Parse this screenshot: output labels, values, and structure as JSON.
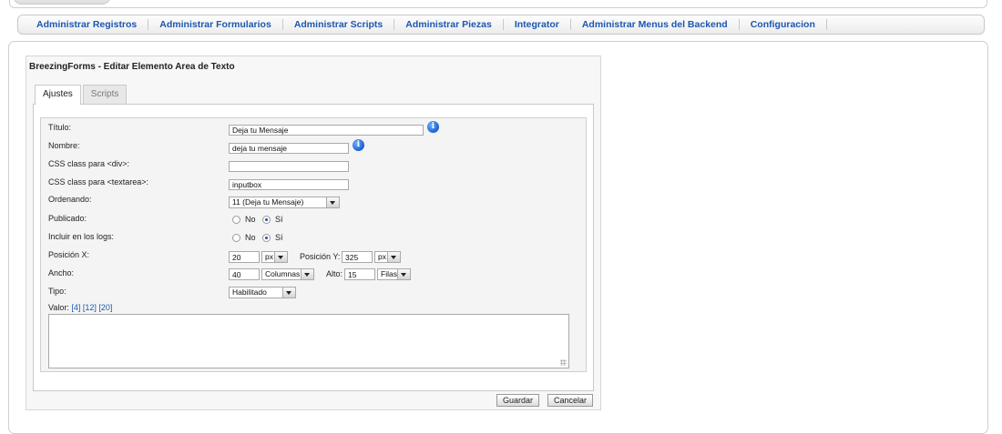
{
  "menu": {
    "items": [
      {
        "id": "registros",
        "label": "Administrar Registros"
      },
      {
        "id": "formularios",
        "label": "Administrar Formularios"
      },
      {
        "id": "scripts",
        "label": "Administrar Scripts"
      },
      {
        "id": "piezas",
        "label": "Administrar Piezas"
      },
      {
        "id": "integrator",
        "label": "Integrator"
      },
      {
        "id": "menus-backend",
        "label": "Administrar Menus del Backend"
      },
      {
        "id": "configuracion",
        "label": "Configuracion"
      }
    ]
  },
  "panel": {
    "title": "BreezingForms - Editar Elemento Area de Texto",
    "tabs": {
      "ajustes": "Ajustes",
      "scripts": "Scripts"
    }
  },
  "form": {
    "titulo": {
      "label": "Título:",
      "value": "Deja tu Mensaje"
    },
    "nombre": {
      "label": "Nombre:",
      "value": "deja tu mensaje"
    },
    "css_div": {
      "label": "CSS class para <div>:",
      "value": ""
    },
    "css_textarea": {
      "label": "CSS class para <textarea>:",
      "value": "inputbox"
    },
    "ordenando": {
      "label": "Ordenando:",
      "value": "11 (Deja tu Mensaje)"
    },
    "publicado": {
      "label": "Publicado:",
      "no": "No",
      "si": "Sí",
      "selected": "si"
    },
    "logs": {
      "label": "Incluir en los logs:",
      "no": "No",
      "si": "Sí",
      "selected": "si"
    },
    "posicion": {
      "label": "Posición X:",
      "x_value": "20",
      "x_unit": "px",
      "y_label": "Posición Y:",
      "y_value": "325",
      "y_unit": "px"
    },
    "ancho": {
      "label": "Ancho:",
      "value": "40",
      "unit": "Columnas",
      "alto_label": "Alto:",
      "alto_value": "15",
      "alto_unit": "Filas"
    },
    "tipo": {
      "label": "Tipo:",
      "value": "Habilitado"
    },
    "valor": {
      "label": "Valor:",
      "links": [
        "[4]",
        "[12]",
        "[20]"
      ],
      "value": ""
    }
  },
  "buttons": {
    "guardar": "Guardar",
    "cancelar": "Cancelar"
  },
  "icons": {
    "info": "info-icon"
  },
  "colors": {
    "link": "#1b57b1",
    "info": "#1a5fd0"
  }
}
